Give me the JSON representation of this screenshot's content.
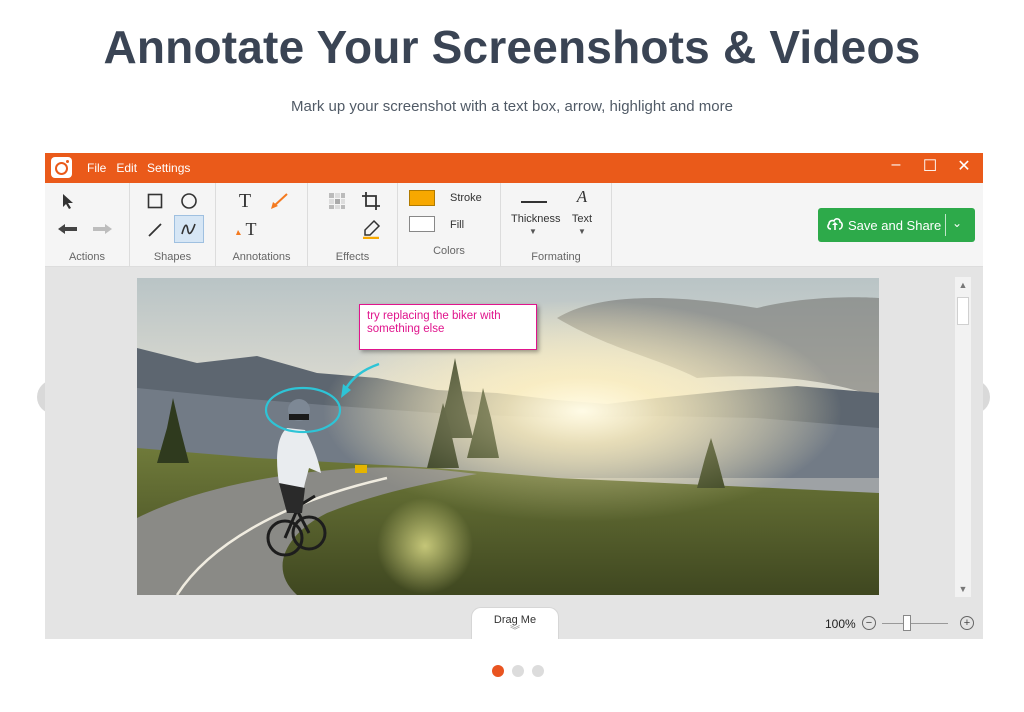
{
  "hero": {
    "title": "Annotate Your Screenshots & Videos",
    "subtitle": "Mark up your screenshot with a text box, arrow, highlight and more"
  },
  "menu": {
    "items": [
      "File",
      "Edit",
      "Settings"
    ]
  },
  "window_controls": {
    "minimize": "–",
    "maximize": "☐",
    "close": "✕"
  },
  "toolbar": {
    "groups": {
      "actions": "Actions",
      "shapes": "Shapes",
      "annotations": "Annotations",
      "effects": "Effects",
      "colors": "Colors",
      "formatting": "Formating"
    },
    "stroke_label": "Stroke",
    "fill_label": "Fill",
    "stroke_color": "#f7a800",
    "fill_color": "#ffffff",
    "thickness_label": "Thickness",
    "text_label": "Text",
    "text_glyph": "A",
    "annot_text_glyph": "T",
    "annot_text2_glyph": "T"
  },
  "save_button": {
    "label": "Save and Share",
    "dropdown": "⌄",
    "color": "#2daa4a"
  },
  "annotation": {
    "note_text": "try replacing the biker with something else",
    "note_color": "#e0148c",
    "ellipse_color": "#2ec4d6"
  },
  "statusbar": {
    "drag_label": "Drag Me",
    "zoom": "100%",
    "zoom_minus": "−",
    "zoom_plus": "+",
    "zoom_fraction": 0.35
  },
  "carousel": {
    "active_index": 0,
    "count": 3,
    "accent": "#e95420"
  },
  "theme": {
    "titlebar": "#ea5a1a"
  }
}
